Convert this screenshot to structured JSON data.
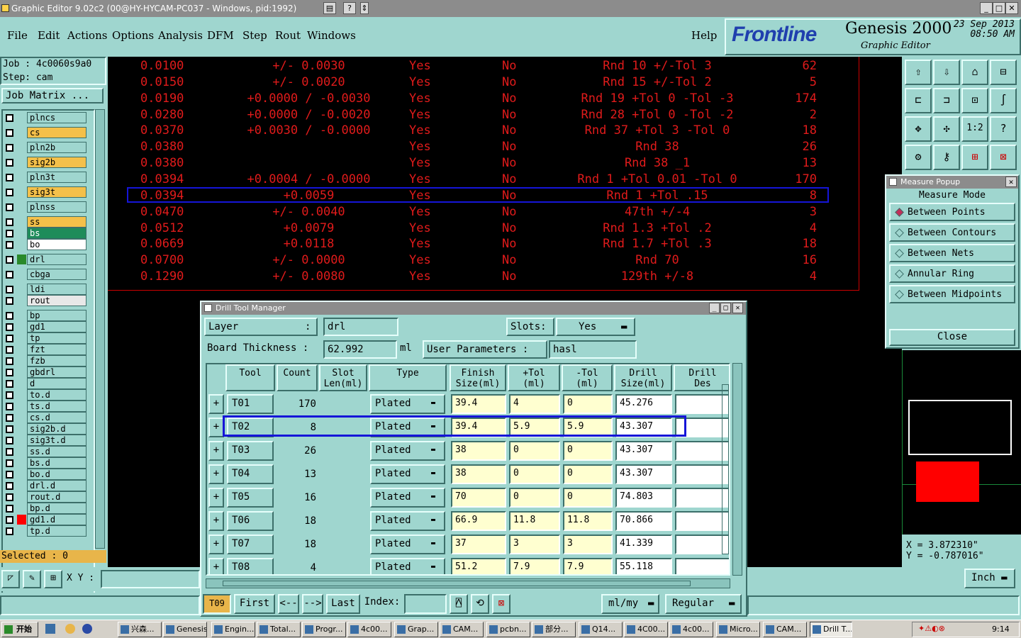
{
  "window": {
    "title": "Graphic Editor 9.02c2 (00@HY-HYCAM-PC037 - Windows, pid:1992)"
  },
  "menu": {
    "items": [
      "File",
      "Edit",
      "Actions",
      "Options",
      "Analysis",
      "DFM",
      "Step",
      "Rout",
      "Windows"
    ],
    "help": "Help"
  },
  "brand": {
    "logo": "Frontline",
    "product": "Genesis 2000",
    "subtitle": "Graphic Editor",
    "date": "23 Sep 2013",
    "time": "08:50 AM"
  },
  "job": {
    "job_label": "Job : 4c0060s9a0",
    "step_label": "Step: cam",
    "job_matrix": "Job Matrix ..."
  },
  "layers": [
    {
      "name": "plncs",
      "color": "#9fd6cf"
    },
    {
      "name": "cs",
      "color": "#f4c04a"
    },
    {
      "name": "pln2b",
      "color": "#9fd6cf"
    },
    {
      "name": "sig2b",
      "color": "#f4c04a"
    },
    {
      "name": "pln3t",
      "color": "#9fd6cf"
    },
    {
      "name": "sig3t",
      "color": "#f4c04a"
    },
    {
      "name": "plnss",
      "color": "#9fd6cf"
    },
    {
      "name": "ss",
      "color": "#f4c04a"
    },
    {
      "name": "bs",
      "color": "#1e8c5a"
    },
    {
      "name": "bo",
      "color": "#ffffff"
    },
    {
      "name": "drl",
      "color": "#9fd6cf"
    },
    {
      "name": "cbga",
      "color": "#9fd6cf"
    },
    {
      "name": "ldi",
      "color": "#9fd6cf"
    },
    {
      "name": "rout",
      "color": "#e8e8e8"
    },
    {
      "name": "bp",
      "color": "#9fd6cf"
    },
    {
      "name": "gd1",
      "color": "#9fd6cf"
    },
    {
      "name": "tp",
      "color": "#9fd6cf"
    },
    {
      "name": "fzt",
      "color": "#9fd6cf"
    },
    {
      "name": "fzb",
      "color": "#9fd6cf"
    },
    {
      "name": "gbdrl",
      "color": "#9fd6cf"
    },
    {
      "name": "d",
      "color": "#9fd6cf"
    },
    {
      "name": "to.d",
      "color": "#9fd6cf"
    },
    {
      "name": "ts.d",
      "color": "#9fd6cf"
    },
    {
      "name": "cs.d",
      "color": "#9fd6cf"
    },
    {
      "name": "sig2b.d",
      "color": "#9fd6cf"
    },
    {
      "name": "sig3t.d",
      "color": "#9fd6cf"
    },
    {
      "name": "ss.d",
      "color": "#9fd6cf"
    },
    {
      "name": "bs.d",
      "color": "#9fd6cf"
    },
    {
      "name": "bo.d",
      "color": "#9fd6cf"
    },
    {
      "name": "drl.d",
      "color": "#9fd6cf"
    },
    {
      "name": "rout.d",
      "color": "#9fd6cf"
    },
    {
      "name": "bp.d",
      "color": "#9fd6cf"
    },
    {
      "name": "gd1.d",
      "color": "#9fd6cf"
    },
    {
      "name": "tp.d",
      "color": "#9fd6cf"
    }
  ],
  "selected_label": "Selected : 0",
  "xy_label": "X Y :",
  "red_table": [
    [
      "0.0100",
      "+/- 0.0030",
      "Yes",
      "No",
      "Rnd 10 +/-Tol 3",
      "62"
    ],
    [
      "0.0150",
      "+/- 0.0020",
      "Yes",
      "No",
      "Rnd 15 +/-Tol 2",
      "5"
    ],
    [
      "0.0190",
      "+0.0000 / -0.0030",
      "Yes",
      "No",
      "Rnd 19 +Tol 0 -Tol -3",
      "174"
    ],
    [
      "0.0280",
      "+0.0000 / -0.0020",
      "Yes",
      "No",
      "Rnd 28 +Tol 0 -Tol -2",
      "2"
    ],
    [
      "0.0370",
      "+0.0030 / -0.0000",
      "Yes",
      "No",
      "Rnd 37 +Tol 3 -Tol 0",
      "18"
    ],
    [
      "0.0380",
      "",
      "Yes",
      "No",
      "Rnd 38",
      "26"
    ],
    [
      "0.0380",
      "",
      "Yes",
      "No",
      "Rnd 38 _1",
      "13"
    ],
    [
      "0.0394",
      "+0.0004 / -0.0000",
      "Yes",
      "No",
      "Rnd 1 +Tol 0.01 -Tol 0",
      "170"
    ],
    [
      "0.0394",
      "+0.0059",
      "Yes",
      "No",
      "Rnd 1 +Tol .15",
      "8"
    ],
    [
      "0.0470",
      "+/- 0.0040",
      "Yes",
      "No",
      "47th +/-4",
      "3"
    ],
    [
      "0.0512",
      "+0.0079",
      "Yes",
      "No",
      "Rnd 1.3 +Tol .2",
      "4"
    ],
    [
      "0.0669",
      "+0.0118",
      "Yes",
      "No",
      "Rnd 1.7 +Tol .3",
      "18"
    ],
    [
      "0.0700",
      "+/- 0.0000",
      "Yes",
      "No",
      "Rnd 70",
      "16"
    ],
    [
      "0.1290",
      "+/- 0.0080",
      "Yes",
      "No",
      "129th +/-8",
      "4"
    ]
  ],
  "measure": {
    "title": "Measure Popup",
    "mode_label": "Measure Mode",
    "options": [
      "Between Points",
      "Between Contours",
      "Between Nets",
      "Annular Ring",
      "Between Midpoints"
    ],
    "close": "Close"
  },
  "coords": {
    "x": "X = 3.872310\"",
    "y": "Y = -0.787016\""
  },
  "units": "Inch",
  "dtm": {
    "title": "Drill Tool Manager",
    "layer_label": "Layer",
    "layer_colon": ":",
    "layer_value": "drl",
    "slots_label": "Slots:",
    "slots_value": "Yes",
    "thickness_label": "Board Thickness :",
    "thickness_value": "62.992",
    "thickness_unit": "ml",
    "user_params_label": "User Parameters :",
    "user_params_value": "hasl",
    "headers": [
      "Tool",
      "Count",
      "Slot\nLen(ml)",
      "Type",
      "Finish\nSize(ml)",
      "+Tol\n(ml)",
      "-Tol\n(ml)",
      "Drill\nSize(ml)",
      "Drill\nDes"
    ],
    "rows": [
      {
        "tool": "T01",
        "count": "170",
        "type": "Plated",
        "finish": "39.4",
        "ptol": "4",
        "mtol": "0",
        "drill": "45.276"
      },
      {
        "tool": "T02",
        "count": "8",
        "type": "Plated",
        "finish": "39.4",
        "ptol": "5.9",
        "mtol": "5.9",
        "drill": "43.307"
      },
      {
        "tool": "T03",
        "count": "26",
        "type": "Plated",
        "finish": "38",
        "ptol": "0",
        "mtol": "0",
        "drill": "43.307"
      },
      {
        "tool": "T04",
        "count": "13",
        "type": "Plated",
        "finish": "38",
        "ptol": "0",
        "mtol": "0",
        "drill": "43.307"
      },
      {
        "tool": "T05",
        "count": "16",
        "type": "Plated",
        "finish": "70",
        "ptol": "0",
        "mtol": "0",
        "drill": "74.803"
      },
      {
        "tool": "T06",
        "count": "18",
        "type": "Plated",
        "finish": "66.9",
        "ptol": "11.8",
        "mtol": "11.8",
        "drill": "70.866"
      },
      {
        "tool": "T07",
        "count": "18",
        "type": "Plated",
        "finish": "37",
        "ptol": "3",
        "mtol": "3",
        "drill": "41.339"
      },
      {
        "tool": "T08",
        "count": "4",
        "type": "Plated",
        "finish": "51.2",
        "ptol": "7.9",
        "mtol": "7.9",
        "drill": "55.118"
      }
    ],
    "footer": {
      "current": "T09",
      "first": "First",
      "prev": "<--",
      "next": "-->",
      "last": "Last",
      "index_label": "Index:",
      "unit_mode": "ml/my",
      "mode": "Regular"
    }
  },
  "taskbar": {
    "start": "开始",
    "tasks": [
      "兴森...",
      "Genesis",
      "Engin...",
      "Total...",
      "Progr...",
      "4c00...",
      "Grap...",
      "CAM...",
      "pcbn...",
      "部分...",
      "Q14...",
      "4C00...",
      "4c00...",
      "Micro...",
      "CAM...",
      "Drill T..."
    ],
    "clock": "9:14"
  }
}
